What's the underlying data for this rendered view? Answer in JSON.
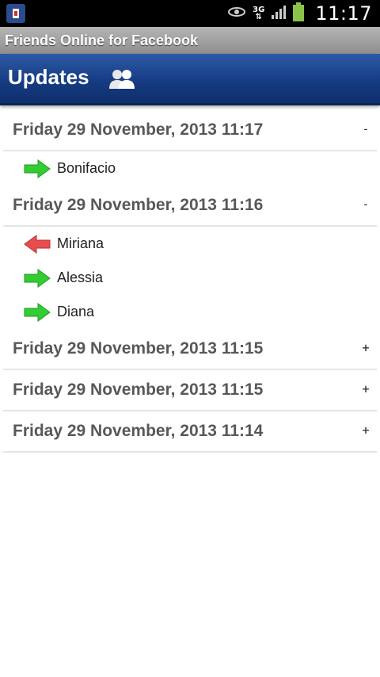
{
  "status_bar": {
    "time": "11:17",
    "network": "3G",
    "icons": [
      "app-icon",
      "eye-icon",
      "3g-icon",
      "signal-icon",
      "battery-icon"
    ]
  },
  "app_title": "Friends Online for Facebook",
  "action_bar": {
    "title": "Updates",
    "icon": "friends-icon"
  },
  "colors": {
    "online": "#33cc33",
    "offline": "#e84c4c",
    "header_blue": "#143a80"
  },
  "groups": [
    {
      "date": "Friday 29 November, 2013 11:17",
      "toggle": "-",
      "children": [
        {
          "name": "Bonifacio",
          "status": "online"
        }
      ]
    },
    {
      "date": "Friday 29 November, 2013 11:16",
      "toggle": "-",
      "children": [
        {
          "name": "Miriana",
          "status": "offline"
        },
        {
          "name": "Alessia",
          "status": "online"
        },
        {
          "name": "Diana",
          "status": "online"
        }
      ]
    },
    {
      "date": "Friday 29 November, 2013 11:15",
      "toggle": "+",
      "children": []
    },
    {
      "date": "Friday 29 November, 2013 11:15",
      "toggle": "+",
      "children": []
    },
    {
      "date": "Friday 29 November, 2013 11:14",
      "toggle": "+",
      "children": []
    }
  ]
}
